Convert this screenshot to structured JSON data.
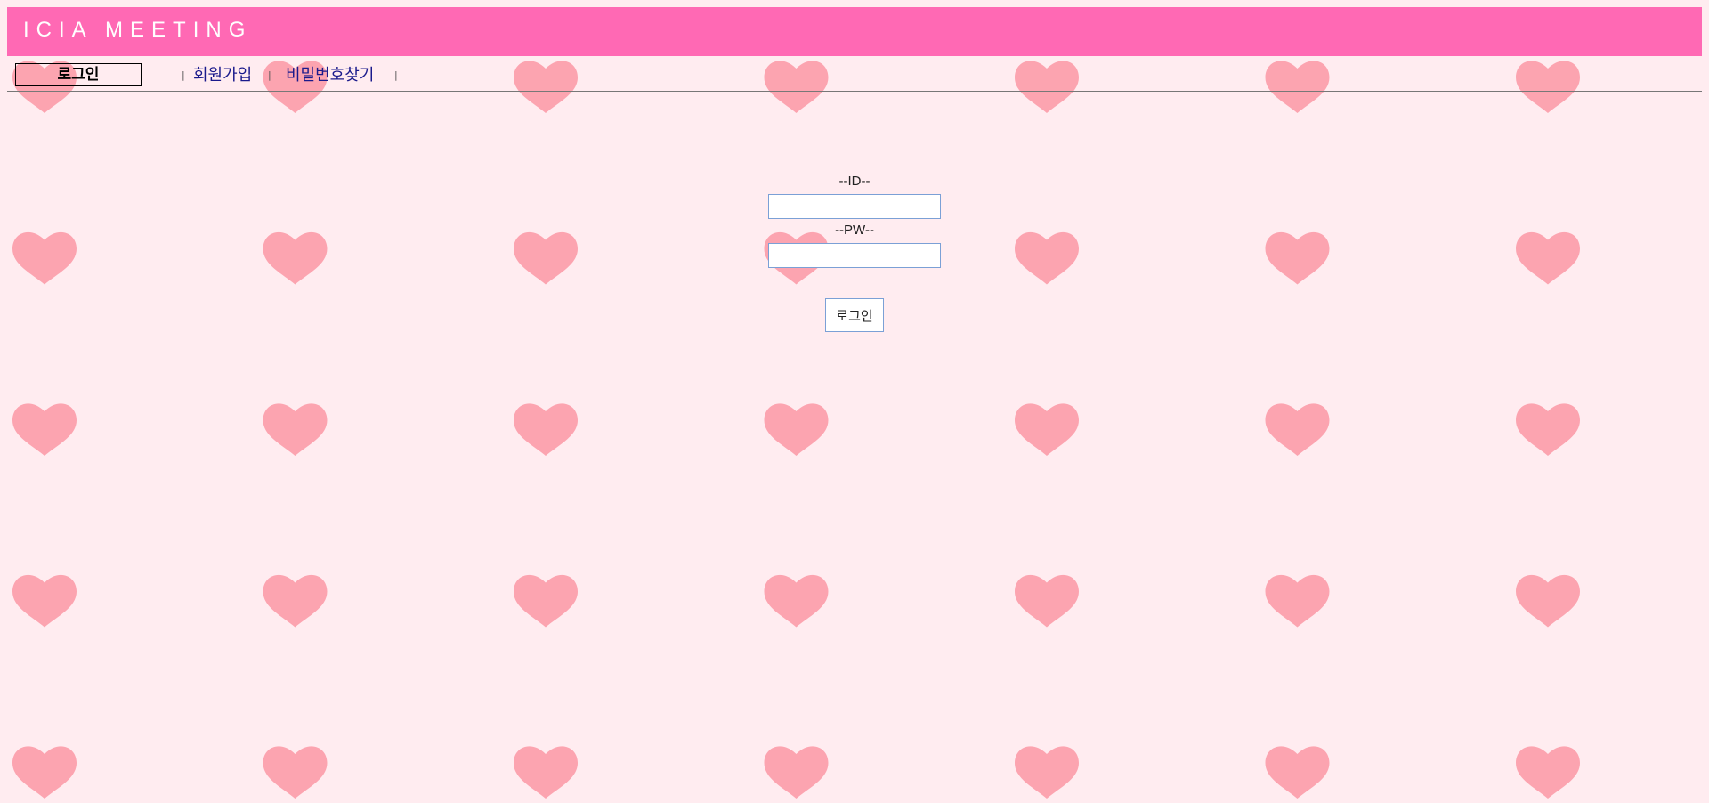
{
  "header": {
    "title": "ICIA MEETING"
  },
  "nav": {
    "login_label": "로그인",
    "separator": "|",
    "signup_label": "회원가입",
    "find_password_label": "비밀번호찾기"
  },
  "form": {
    "id_label": "--ID--",
    "id_value": "",
    "pw_label": "--PW--",
    "pw_value": "",
    "submit_label": "로그인"
  },
  "colors": {
    "header_bg": "#ff69b4",
    "page_bg": "#ffecf0",
    "heart": "#fca4b0",
    "link": "#1a1a8c",
    "input_border": "#7ba0d6"
  },
  "background": {
    "pattern_icon": "heart-icon",
    "columns": 7,
    "rows": 5
  }
}
